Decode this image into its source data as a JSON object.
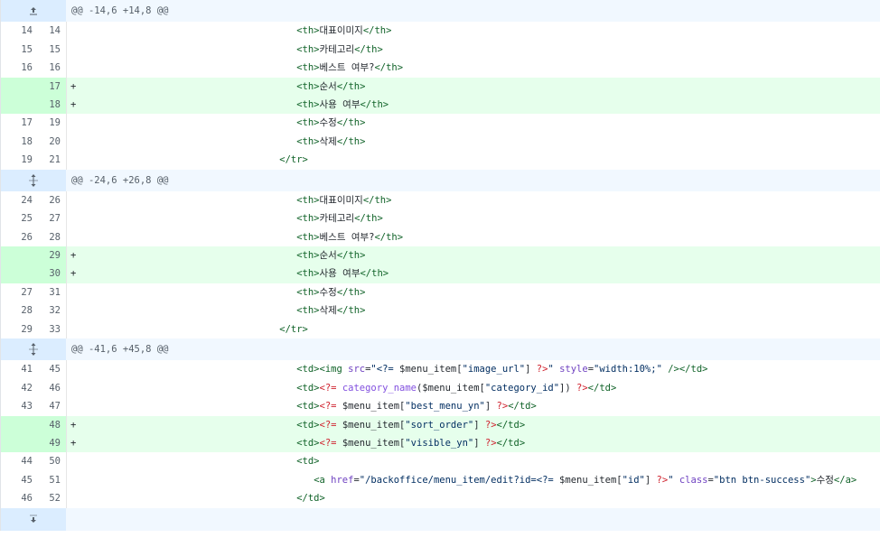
{
  "hunks": [
    {
      "header": "@@ -14,6 +14,8 @@",
      "expand_icon": "expand-up-icon",
      "lines": [
        {
          "old": "14",
          "new": "14",
          "type": "ctx",
          "indent": 38,
          "parts": [
            [
              "tag",
              "<th>"
            ],
            [
              "plain",
              "대표이미지"
            ],
            [
              "tag",
              "</th>"
            ]
          ]
        },
        {
          "old": "15",
          "new": "15",
          "type": "ctx",
          "indent": 38,
          "parts": [
            [
              "tag",
              "<th>"
            ],
            [
              "plain",
              "카테고리"
            ],
            [
              "tag",
              "</th>"
            ]
          ]
        },
        {
          "old": "16",
          "new": "16",
          "type": "ctx",
          "indent": 38,
          "parts": [
            [
              "tag",
              "<th>"
            ],
            [
              "plain",
              "베스트 여부?"
            ],
            [
              "tag",
              "</th>"
            ]
          ]
        },
        {
          "old": "",
          "new": "17",
          "type": "add",
          "indent": 38,
          "parts": [
            [
              "tag",
              "<th>"
            ],
            [
              "plain",
              "순서"
            ],
            [
              "tag",
              "</th>"
            ]
          ]
        },
        {
          "old": "",
          "new": "18",
          "type": "add",
          "indent": 38,
          "parts": [
            [
              "tag",
              "<th>"
            ],
            [
              "plain",
              "사용 여부"
            ],
            [
              "tag",
              "</th>"
            ]
          ]
        },
        {
          "old": "17",
          "new": "19",
          "type": "ctx",
          "indent": 38,
          "parts": [
            [
              "tag",
              "<th>"
            ],
            [
              "plain",
              "수정"
            ],
            [
              "tag",
              "</th>"
            ]
          ]
        },
        {
          "old": "18",
          "new": "20",
          "type": "ctx",
          "indent": 38,
          "parts": [
            [
              "tag",
              "<th>"
            ],
            [
              "plain",
              "삭제"
            ],
            [
              "tag",
              "</th>"
            ]
          ]
        },
        {
          "old": "19",
          "new": "21",
          "type": "ctx",
          "indent": 35,
          "parts": [
            [
              "tag",
              "</tr>"
            ]
          ]
        }
      ]
    },
    {
      "header": "@@ -24,6 +26,8 @@",
      "expand_icon": "expand-both-icon",
      "lines": [
        {
          "old": "24",
          "new": "26",
          "type": "ctx",
          "indent": 38,
          "parts": [
            [
              "tag",
              "<th>"
            ],
            [
              "plain",
              "대표이미지"
            ],
            [
              "tag",
              "</th>"
            ]
          ]
        },
        {
          "old": "25",
          "new": "27",
          "type": "ctx",
          "indent": 38,
          "parts": [
            [
              "tag",
              "<th>"
            ],
            [
              "plain",
              "카테고리"
            ],
            [
              "tag",
              "</th>"
            ]
          ]
        },
        {
          "old": "26",
          "new": "28",
          "type": "ctx",
          "indent": 38,
          "parts": [
            [
              "tag",
              "<th>"
            ],
            [
              "plain",
              "베스트 여부?"
            ],
            [
              "tag",
              "</th>"
            ]
          ]
        },
        {
          "old": "",
          "new": "29",
          "type": "add",
          "indent": 38,
          "parts": [
            [
              "tag",
              "<th>"
            ],
            [
              "plain",
              "순서"
            ],
            [
              "tag",
              "</th>"
            ]
          ]
        },
        {
          "old": "",
          "new": "30",
          "type": "add",
          "indent": 38,
          "parts": [
            [
              "tag",
              "<th>"
            ],
            [
              "plain",
              "사용 여부"
            ],
            [
              "tag",
              "</th>"
            ]
          ]
        },
        {
          "old": "27",
          "new": "31",
          "type": "ctx",
          "indent": 38,
          "parts": [
            [
              "tag",
              "<th>"
            ],
            [
              "plain",
              "수정"
            ],
            [
              "tag",
              "</th>"
            ]
          ]
        },
        {
          "old": "28",
          "new": "32",
          "type": "ctx",
          "indent": 38,
          "parts": [
            [
              "tag",
              "<th>"
            ],
            [
              "plain",
              "삭제"
            ],
            [
              "tag",
              "</th>"
            ]
          ]
        },
        {
          "old": "29",
          "new": "33",
          "type": "ctx",
          "indent": 35,
          "parts": [
            [
              "tag",
              "</tr>"
            ]
          ]
        }
      ]
    },
    {
      "header": "@@ -41,6 +45,8 @@",
      "expand_icon": "expand-both-icon",
      "lines": [
        {
          "old": "41",
          "new": "45",
          "type": "ctx",
          "indent": 38,
          "parts": [
            [
              "tag",
              "<td><img "
            ],
            [
              "attr",
              "src"
            ],
            [
              "plain",
              "="
            ],
            [
              "str",
              "\"<?= "
            ],
            [
              "plain",
              "$menu_item["
            ],
            [
              "str",
              "\"image_url\""
            ],
            [
              "plain",
              "] "
            ],
            [
              "php",
              "?>"
            ],
            [
              "str",
              "\""
            ],
            [
              "plain",
              " "
            ],
            [
              "attr",
              "style"
            ],
            [
              "plain",
              "="
            ],
            [
              "str",
              "\"width:10%;\""
            ],
            [
              "plain",
              " "
            ],
            [
              "tag",
              "/></td>"
            ]
          ]
        },
        {
          "old": "42",
          "new": "46",
          "type": "ctx",
          "indent": 38,
          "parts": [
            [
              "tag",
              "<td>"
            ],
            [
              "php",
              "<?= "
            ],
            [
              "fn",
              "category_name"
            ],
            [
              "plain",
              "($menu_item["
            ],
            [
              "str",
              "\"category_id\""
            ],
            [
              "plain",
              "]) "
            ],
            [
              "php",
              "?>"
            ],
            [
              "tag",
              "</td>"
            ]
          ]
        },
        {
          "old": "43",
          "new": "47",
          "type": "ctx",
          "indent": 38,
          "parts": [
            [
              "tag",
              "<td>"
            ],
            [
              "php",
              "<?= "
            ],
            [
              "plain",
              "$menu_item["
            ],
            [
              "str",
              "\"best_menu_yn\""
            ],
            [
              "plain",
              "] "
            ],
            [
              "php",
              "?>"
            ],
            [
              "tag",
              "</td>"
            ]
          ]
        },
        {
          "old": "",
          "new": "48",
          "type": "add",
          "indent": 38,
          "parts": [
            [
              "tag",
              "<td>"
            ],
            [
              "php",
              "<?= "
            ],
            [
              "plain",
              "$menu_item["
            ],
            [
              "str",
              "\"sort_order\""
            ],
            [
              "plain",
              "] "
            ],
            [
              "php",
              "?>"
            ],
            [
              "tag",
              "</td>"
            ]
          ]
        },
        {
          "old": "",
          "new": "49",
          "type": "add",
          "indent": 38,
          "parts": [
            [
              "tag",
              "<td>"
            ],
            [
              "php",
              "<?= "
            ],
            [
              "plain",
              "$menu_item["
            ],
            [
              "str",
              "\"visible_yn\""
            ],
            [
              "plain",
              "] "
            ],
            [
              "php",
              "?>"
            ],
            [
              "tag",
              "</td>"
            ]
          ]
        },
        {
          "old": "44",
          "new": "50",
          "type": "ctx",
          "indent": 38,
          "parts": [
            [
              "tag",
              "<td>"
            ]
          ]
        },
        {
          "old": "45",
          "new": "51",
          "type": "ctx",
          "indent": 41,
          "parts": [
            [
              "tag",
              "<a "
            ],
            [
              "attr",
              "href"
            ],
            [
              "plain",
              "="
            ],
            [
              "str",
              "\"/backoffice/menu_item/edit?id=<?= "
            ],
            [
              "plain",
              "$menu_item["
            ],
            [
              "str",
              "\"id\""
            ],
            [
              "plain",
              "] "
            ],
            [
              "php",
              "?>"
            ],
            [
              "str",
              "\""
            ],
            [
              "plain",
              " "
            ],
            [
              "attr",
              "class"
            ],
            [
              "plain",
              "="
            ],
            [
              "str",
              "\"btn btn-success\""
            ],
            [
              "tag",
              ">"
            ],
            [
              "plain",
              "수정"
            ],
            [
              "tag",
              "</a>"
            ]
          ]
        },
        {
          "old": "46",
          "new": "52",
          "type": "ctx",
          "indent": 38,
          "parts": [
            [
              "tag",
              "</td>"
            ]
          ]
        }
      ]
    }
  ],
  "footer": {
    "expand_icon": "expand-down-icon"
  },
  "add_marker": "+"
}
